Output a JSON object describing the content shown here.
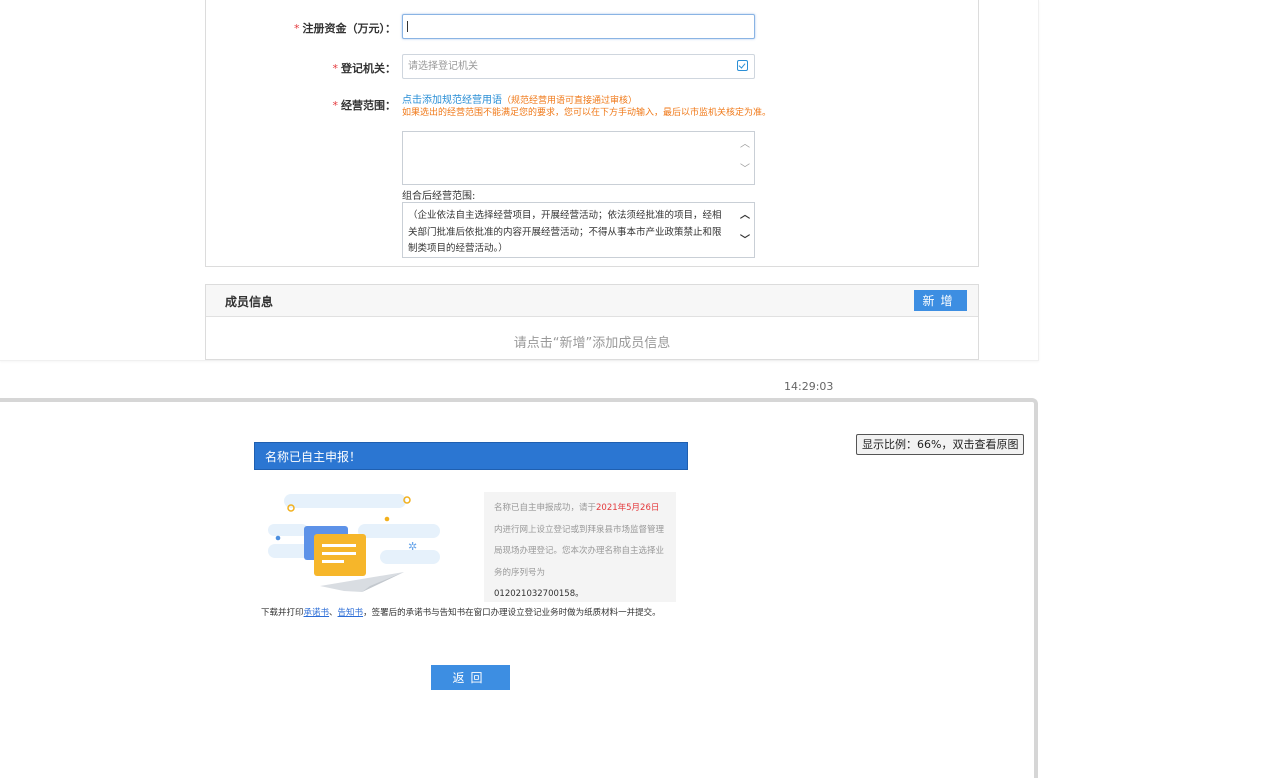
{
  "form": {
    "capital_label": "注册资金（万元）：",
    "authority_label": "登记机关：",
    "authority_placeholder": "请选择登记机关",
    "scope_label": "经营范围：",
    "required_mark": "*",
    "scope_link": "点击添加规范经营用语",
    "scope_link_note": "（规范经营用语可直接通过审核）",
    "scope_hint": "如果选出的经营范围不能满足您的要求，您可以在下方手动输入，最后以市监机关核定为准。",
    "combined_label": "组合后经营范围:",
    "combined_text": "（企业依法自主选择经营项目，开展经营活动；依法须经批准的项目，经相关部门批准后依批准的内容开展经营活动；不得从事本市产业政策禁止和限制类项目的经营活动。）"
  },
  "members": {
    "title": "成员信息",
    "add_button": "新增",
    "empty_text": "请点击“新增”添加成员信息"
  },
  "timestamp": "14:29:03",
  "dialog": {
    "zoom_badge": "显示比例：66%，双击查看原图",
    "header": "名称已自主申报！",
    "info_prefix": "名称已自主申报成功，请于",
    "info_date": "2021年5月26日",
    "info_middle": "内进行网上设立登记或到拜泉县市场监督管理局现场办理登记。您本次办理名称自主选择业务的序列号为",
    "serial": "012021032700158。",
    "download_prefix": "下载并打印",
    "link_commitment": "承诺书",
    "separator": "、",
    "link_notice": "告知书",
    "download_suffix": "，签署后的承诺书与告知书在窗口办理设立登记业务时做为纸质材料一并提交。",
    "back_button": "返回"
  },
  "colors": {
    "primary": "#3d8ee2",
    "header_blue": "#2b76d2",
    "required_red": "#e4393c",
    "hint_orange": "#f07a1a",
    "link_blue": "#2b8fd6"
  }
}
